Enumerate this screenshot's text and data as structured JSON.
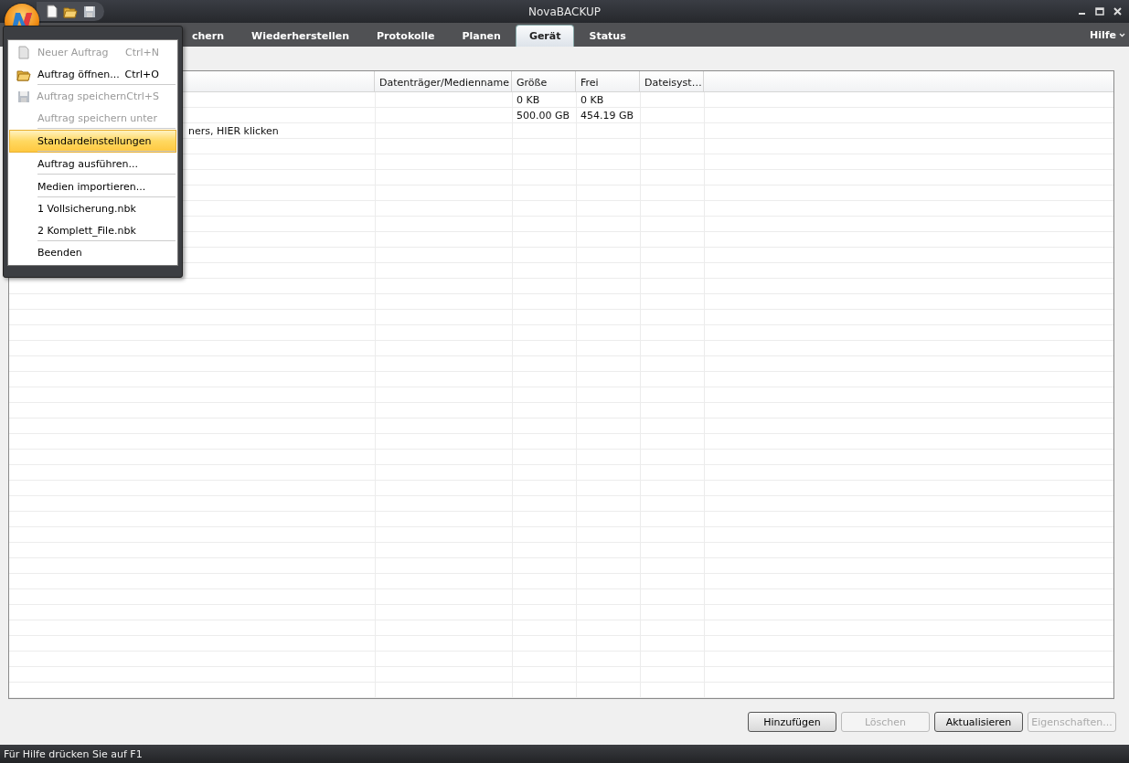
{
  "window": {
    "title": "NovaBACKUP"
  },
  "quick_access": [
    {
      "kind": "new"
    },
    {
      "kind": "open"
    },
    {
      "kind": "save"
    }
  ],
  "tabs": [
    {
      "label": "chern",
      "selected": false
    },
    {
      "label": "Wiederherstellen",
      "selected": false
    },
    {
      "label": "Protokolle",
      "selected": false
    },
    {
      "label": "Planen",
      "selected": false
    },
    {
      "label": "Gerät",
      "selected": true
    },
    {
      "label": "Status",
      "selected": false
    }
  ],
  "help_menu": {
    "label": "Hilfe"
  },
  "table": {
    "columns": [
      "",
      "Datenträger/Medienname",
      "Größe",
      "Frei",
      "Dateisyst…"
    ],
    "rows": [
      {
        "cells": [
          "",
          "",
          "0 KB",
          "0 KB",
          ""
        ]
      },
      {
        "cells": [
          "",
          "",
          "500.00 GB",
          "454.19 GB",
          ""
        ]
      },
      {
        "cells": [
          "ners, HIER klicken",
          "",
          "",
          "",
          ""
        ]
      }
    ]
  },
  "buttons": [
    {
      "label": "Hinzufügen",
      "disabled": false
    },
    {
      "label": "Löschen",
      "disabled": true
    },
    {
      "label": "Aktualisieren",
      "disabled": false
    },
    {
      "label": "Eigenschaften...",
      "disabled": true
    }
  ],
  "app_menu": {
    "items": [
      {
        "label": "Neuer Auftrag",
        "shortcut": "Ctrl+N",
        "kind": "new",
        "disabled": true,
        "selected": false,
        "separator_after": false
      },
      {
        "label": "Auftrag öffnen...",
        "shortcut": "Ctrl+O",
        "kind": "open",
        "disabled": false,
        "selected": false,
        "separator_after": true
      },
      {
        "label": "Auftrag speichern",
        "shortcut": "Ctrl+S",
        "kind": "save",
        "disabled": true,
        "selected": false,
        "separator_after": false
      },
      {
        "label": "Auftrag speichern unter",
        "disabled": true,
        "selected": false,
        "separator_after": true
      },
      {
        "label": "Standardeinstellungen",
        "disabled": false,
        "selected": true,
        "separator_after": true
      },
      {
        "label": "Auftrag ausführen...",
        "disabled": false,
        "selected": false,
        "separator_after": true
      },
      {
        "label": "Medien importieren...",
        "disabled": false,
        "selected": false,
        "separator_after": true
      },
      {
        "label": "1 Vollsicherung.nbk",
        "disabled": false,
        "selected": false,
        "separator_after": false
      },
      {
        "label": "2 Komplett_File.nbk",
        "disabled": false,
        "selected": false,
        "separator_after": true
      },
      {
        "label": "Beenden",
        "disabled": false,
        "selected": false,
        "separator_after": false
      }
    ]
  },
  "status_bar": {
    "text": "Für Hilfe drücken Sie auf F1"
  }
}
